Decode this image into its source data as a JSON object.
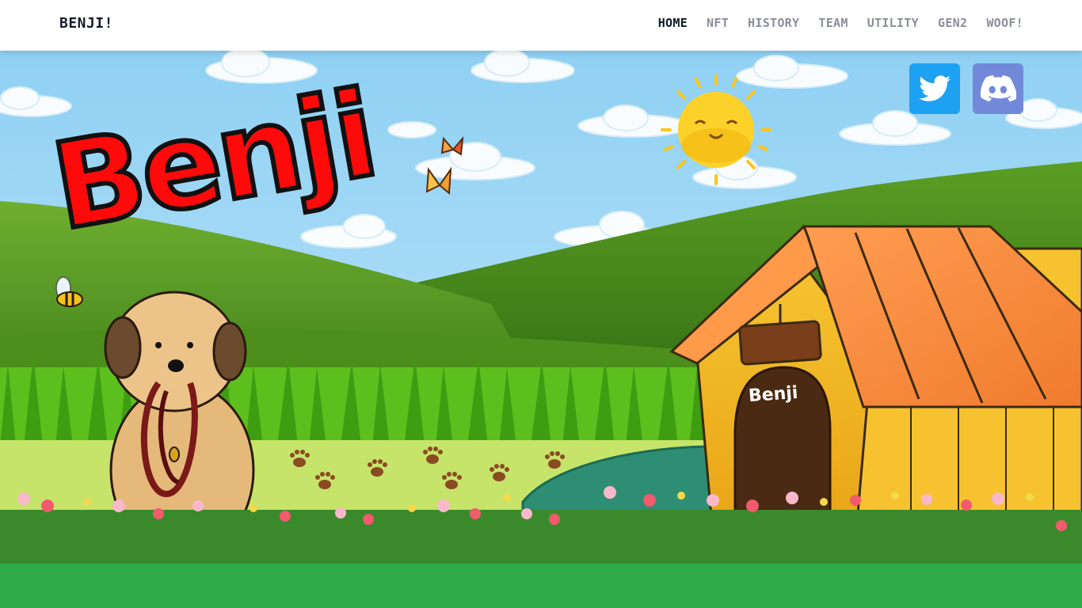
{
  "brand": {
    "label": "BENJI!"
  },
  "nav": {
    "items": [
      {
        "label": "HOME",
        "active": true
      },
      {
        "label": "NFT"
      },
      {
        "label": "HISTORY"
      },
      {
        "label": "TEAM"
      },
      {
        "label": "UTILITY"
      },
      {
        "label": "GEN2"
      },
      {
        "label": "WOOF!"
      }
    ]
  },
  "hero": {
    "title": "Benji",
    "doghouse_sign": "Benji"
  },
  "social": {
    "twitter_icon": "twitter-icon",
    "discord_icon": "discord-icon"
  },
  "colors": {
    "twitter": "#1da1f2",
    "discord": "#7289da",
    "title_red": "#ff0a0a",
    "sky": "#a9dcf5"
  }
}
